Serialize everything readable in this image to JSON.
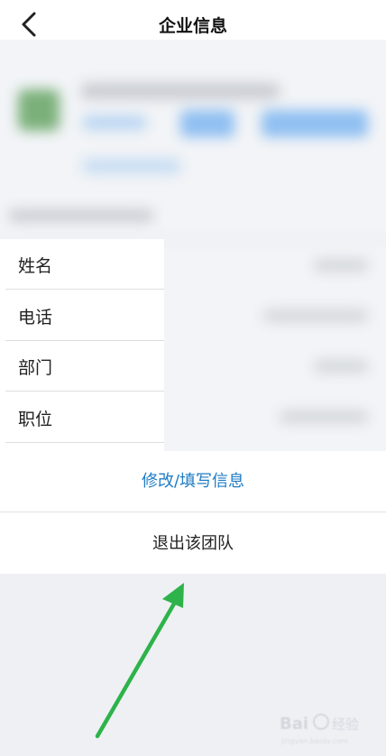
{
  "header": {
    "title": "企业信息",
    "back_icon": "chevron-left-icon"
  },
  "info_list": {
    "rows": [
      {
        "label": "姓名"
      },
      {
        "label": "电话"
      },
      {
        "label": "部门"
      },
      {
        "label": "职位"
      }
    ]
  },
  "action_sheet": {
    "edit_label": "修改/填写信息",
    "quit_label": "退出该团队",
    "accent_color": "#1f7cc4"
  },
  "annotation": {
    "arrow_color": "#2db34a"
  },
  "watermark": {
    "text": "Bai 经验"
  }
}
